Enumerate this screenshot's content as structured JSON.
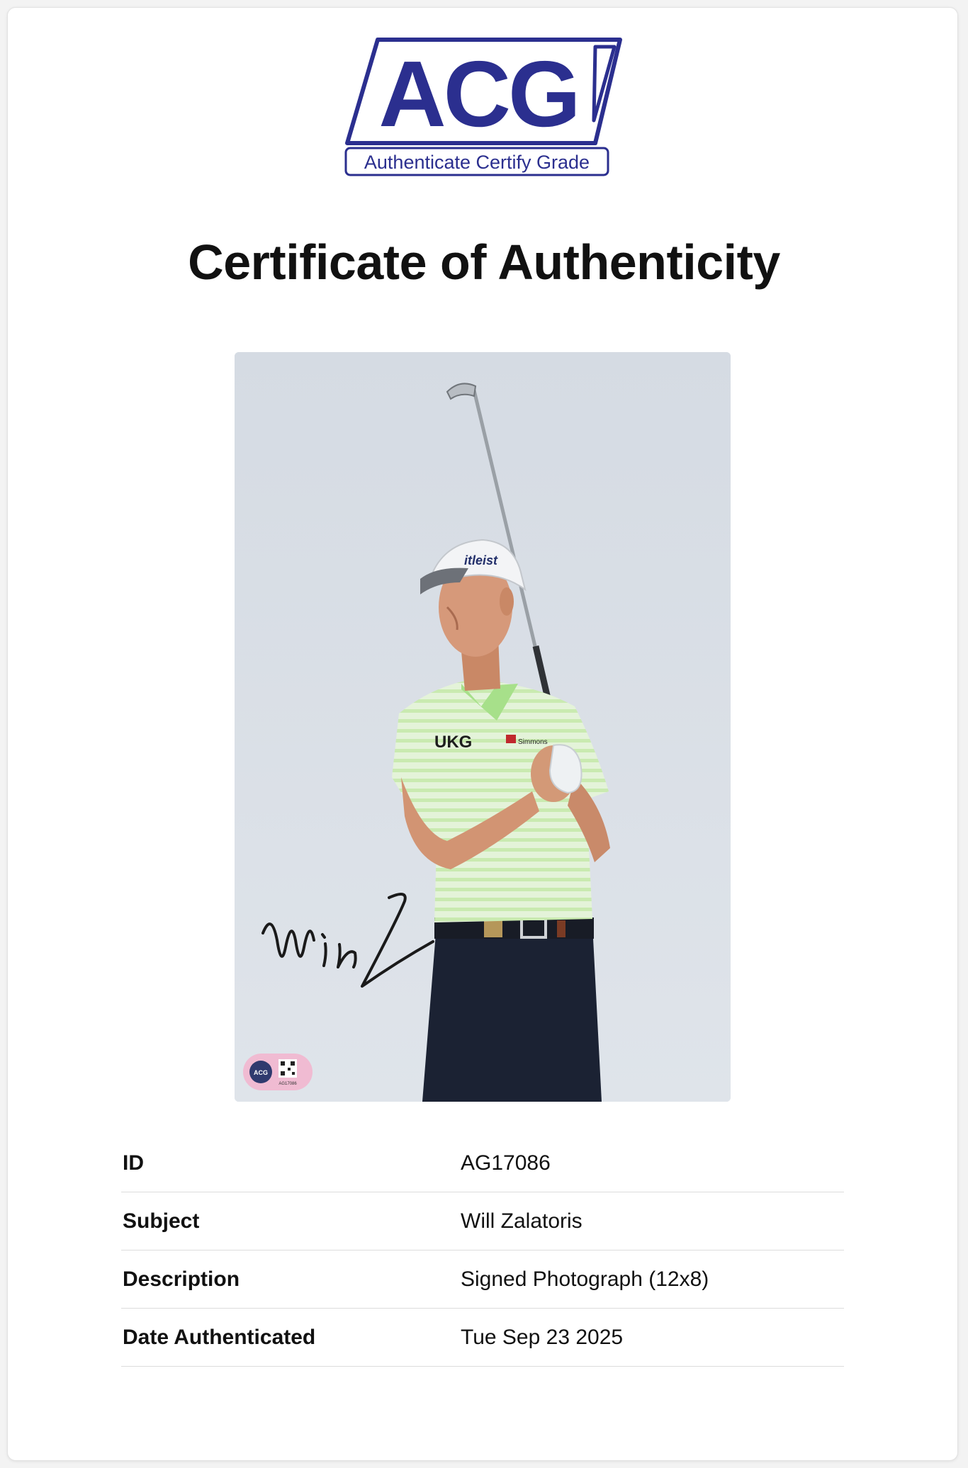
{
  "logo": {
    "brand": "ACG",
    "tagline": "Authenticate Certify Grade",
    "color": "#2b2f8f"
  },
  "title": "Certificate of Authenticity",
  "photo": {
    "signature_text": "Will Z",
    "hologram_id": "AG17086",
    "hologram_brand": "ACG"
  },
  "details": [
    {
      "label": "ID",
      "value": "AG17086"
    },
    {
      "label": "Subject",
      "value": "Will Zalatoris"
    },
    {
      "label": "Description",
      "value": "Signed Photograph (12x8)"
    },
    {
      "label": "Date Authenticated",
      "value": "Tue Sep 23 2025"
    }
  ]
}
